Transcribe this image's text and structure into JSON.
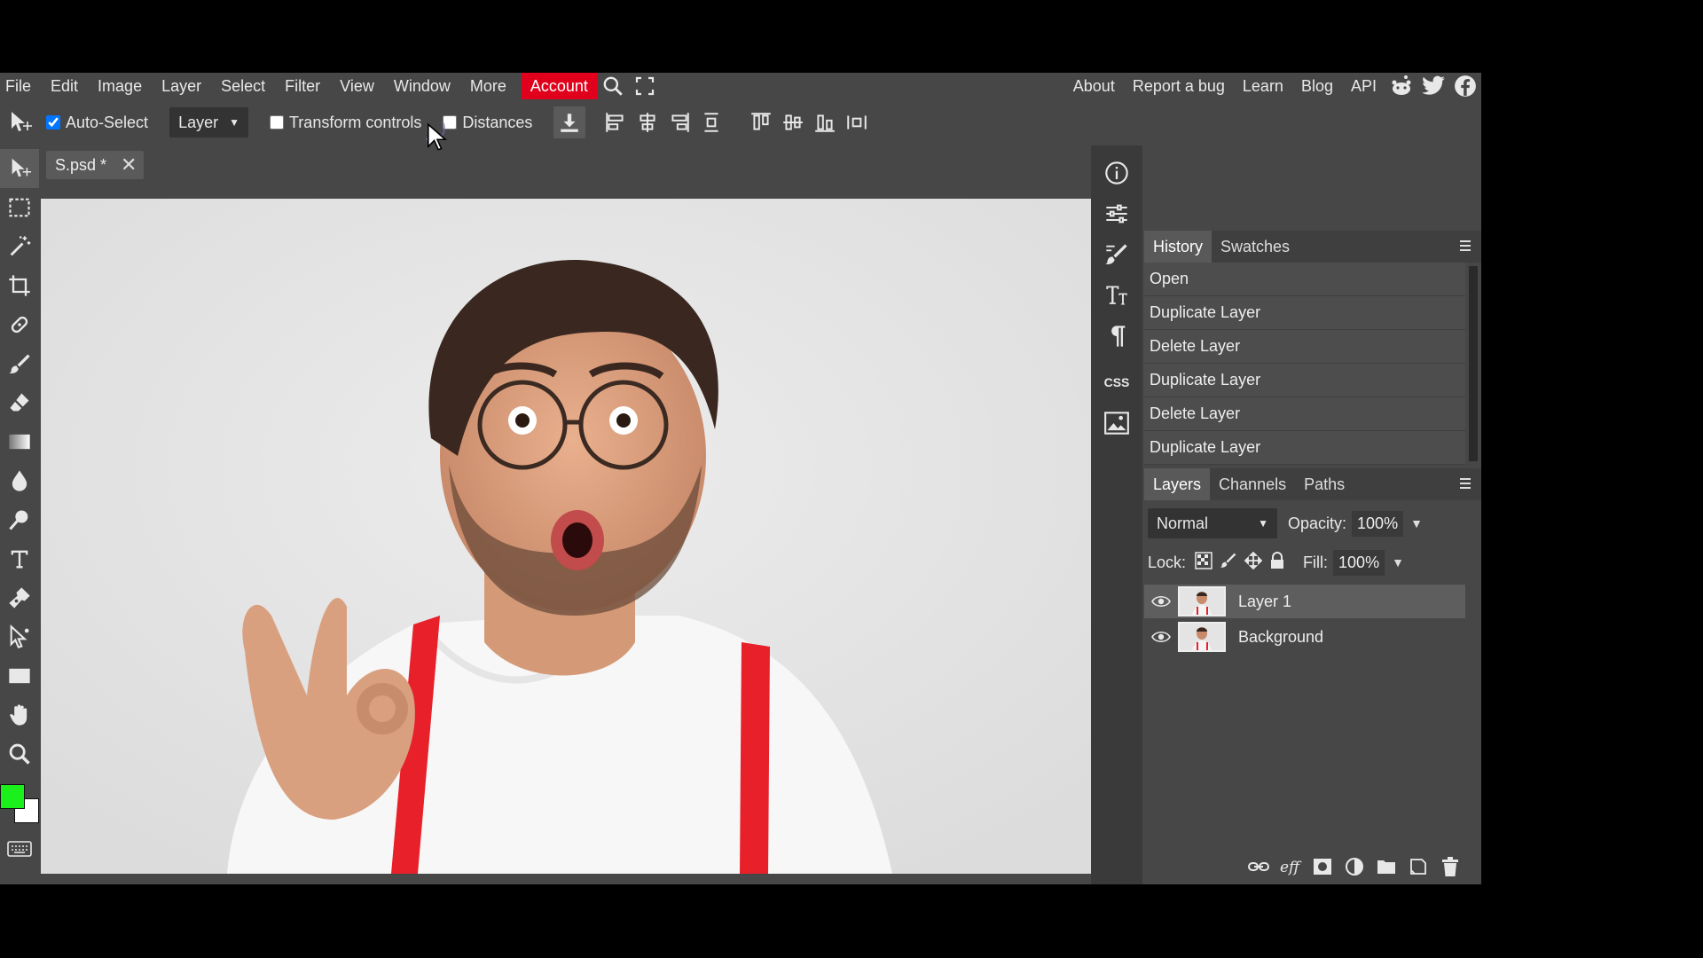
{
  "menu": {
    "items": [
      "File",
      "Edit",
      "Image",
      "Layer",
      "Select",
      "Filter",
      "View",
      "Window",
      "More"
    ],
    "account": "Account",
    "right_links": [
      "About",
      "Report a bug",
      "Learn",
      "Blog",
      "API"
    ]
  },
  "options": {
    "auto_select_label": "Auto-Select",
    "layer_select_value": "Layer",
    "transform_controls_label": "Transform controls",
    "distances_label": "Distances"
  },
  "document": {
    "tab_title": "S.psd *"
  },
  "history": {
    "tabs": [
      "History",
      "Swatches"
    ],
    "items": [
      "Open",
      "Duplicate Layer",
      "Delete Layer",
      "Duplicate Layer",
      "Delete Layer",
      "Duplicate Layer"
    ]
  },
  "layers": {
    "tabs": [
      "Layers",
      "Channels",
      "Paths"
    ],
    "blend_mode": "Normal",
    "opacity_label": "Opacity:",
    "opacity_value": "100%",
    "lock_label": "Lock:",
    "fill_label": "Fill:",
    "fill_value": "100%",
    "items": [
      {
        "name": "Layer 1",
        "selected": true
      },
      {
        "name": "Background",
        "selected": false
      }
    ]
  },
  "right_column": {
    "css_label": "CSS"
  },
  "colors": {
    "foreground": "#1cf01c",
    "background": "#ffffff",
    "account_bg": "#e0001b"
  }
}
